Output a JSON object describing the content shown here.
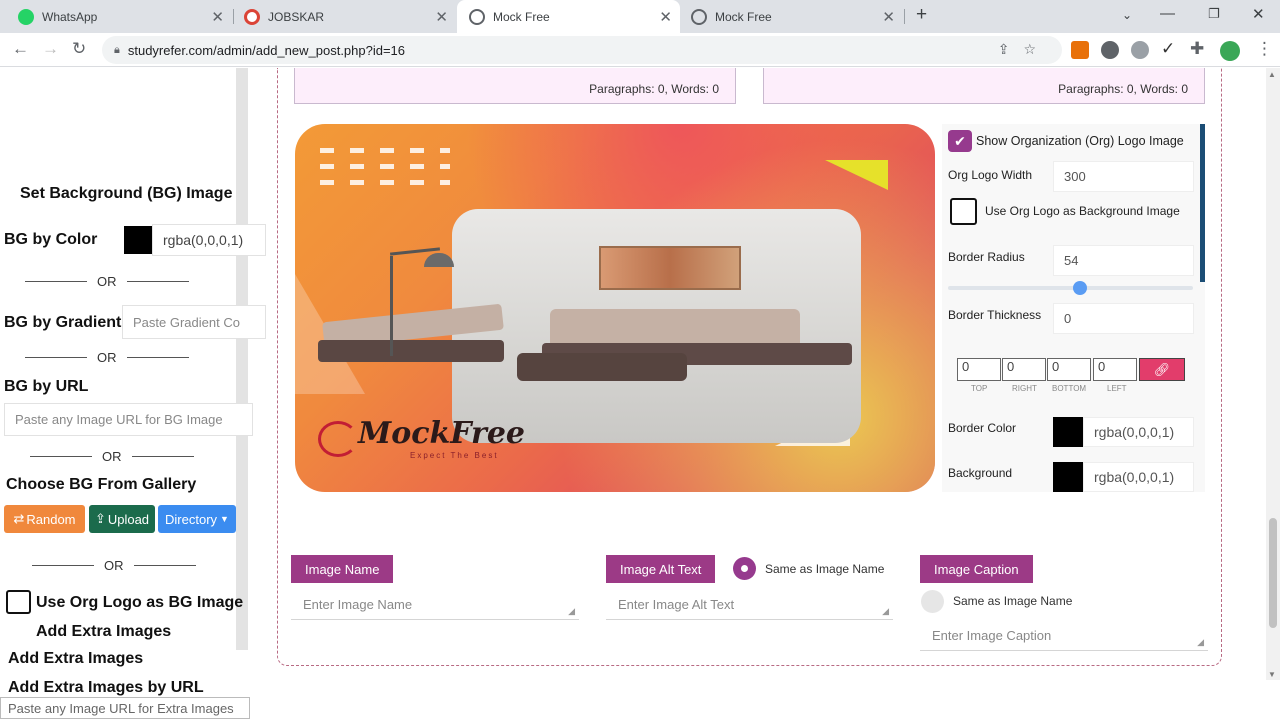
{
  "browser": {
    "tabs": [
      {
        "title": "WhatsApp",
        "icon": "whatsapp-icon"
      },
      {
        "title": "JOBSKAR",
        "icon": "google-icon"
      },
      {
        "title": "Mock Free",
        "icon": "globe-icon"
      },
      {
        "title": "Mock Free",
        "icon": "globe-icon"
      }
    ],
    "url": "studyrefer.com/admin/add_new_post.php?id=16"
  },
  "editor": {
    "paragraphs_left": "Paragraphs: 0, Words: 0",
    "paragraphs_right": "Paragraphs: 0, Words: 0"
  },
  "left": {
    "set_bg_title": "Set Background (BG) Image",
    "bg_by_color": "BG by Color",
    "color_value": "rgba(0,0,0,1)",
    "or": "OR",
    "bg_by_gradient": "BG by Gradient",
    "gradient_placeholder": "Paste Gradient Co",
    "bg_by_url": "BG by URL",
    "url_placeholder": "Paste any Image URL for BG Image",
    "gallery_title": "Choose BG From Gallery",
    "random_btn": "Random",
    "upload_btn": "Upload",
    "directory_btn": "Directory",
    "use_org_logo": "Use Org Logo as BG Image",
    "add_extra_1": "Add Extra Images",
    "add_extra_2": "Add Extra Images",
    "add_extra_url": "Add Extra Images by URL",
    "extra_url_placeholder": "Paste any Image URL for Extra Images"
  },
  "preview": {
    "logo_text": "MockFree",
    "logo_tagline": "Expect The Best"
  },
  "panel": {
    "show_org_logo": "Show Organization (Org) Logo Image",
    "org_logo_width_label": "Org Logo Width",
    "org_logo_width": "300",
    "use_org_logo_bg": "Use Org Logo as Background Image",
    "border_radius_label": "Border Radius",
    "border_radius": "54",
    "border_thickness_label": "Border Thickness",
    "border_thickness": "0",
    "sides": [
      {
        "label": "TOP",
        "value": "0"
      },
      {
        "label": "RIGHT",
        "value": "0"
      },
      {
        "label": "BOTTOM",
        "value": "0"
      },
      {
        "label": "LEFT",
        "value": "0"
      }
    ],
    "border_color_label": "Border Color",
    "border_color": "rgba(0,0,0,1)",
    "background_label": "Background",
    "background": "rgba(0,0,0,1)"
  },
  "bottom": {
    "image_name_btn": "Image Name",
    "image_name_placeholder": "Enter Image Name",
    "alt_text_btn": "Image Alt Text",
    "same_as_name_1": "Same as Image Name",
    "alt_placeholder": "Enter Image Alt Text",
    "caption_btn": "Image Caption",
    "same_as_name_2": "Same as Image Name",
    "caption_placeholder": "Enter Image Caption"
  },
  "colors": {
    "accent": "#9c3a86",
    "random": "#f0883c",
    "upload": "#1b6b4c",
    "directory": "#3b8cf0"
  }
}
